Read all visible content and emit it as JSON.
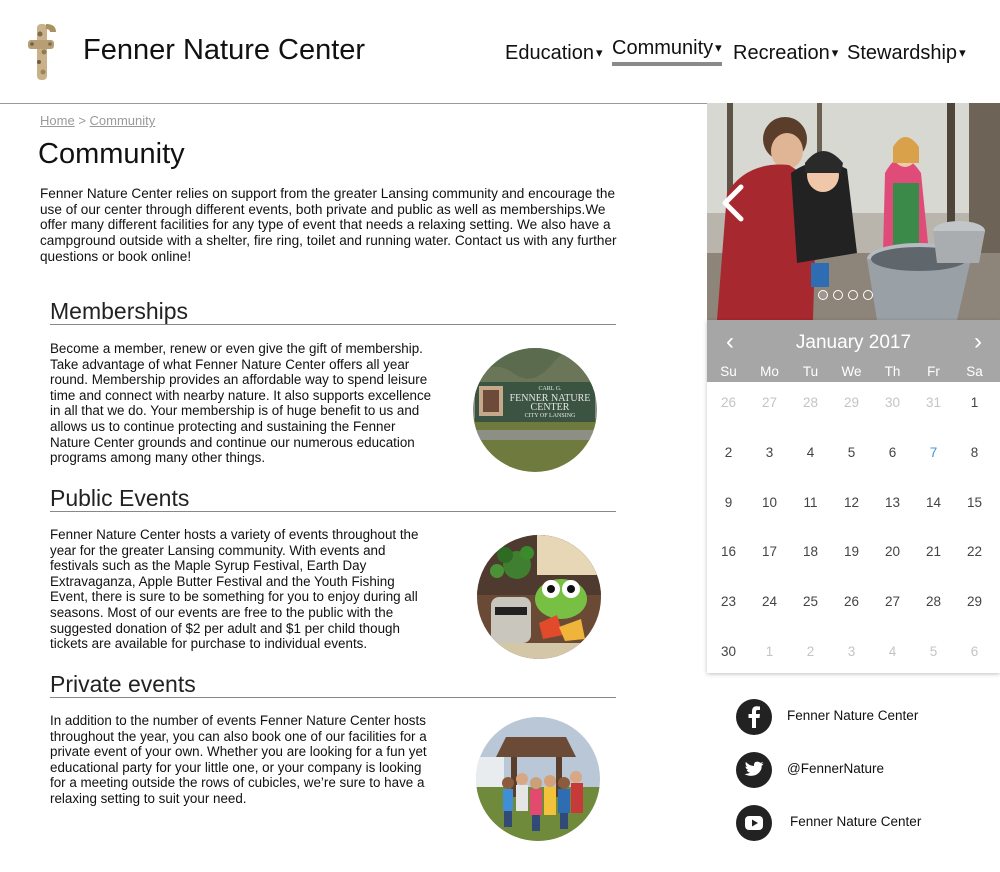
{
  "header": {
    "title": "Fenner Nature Center",
    "nav": [
      {
        "label": "Education",
        "caret": "▾"
      },
      {
        "label": "Community",
        "caret": "▾"
      },
      {
        "label": "Recreation",
        "caret": "▾"
      },
      {
        "label": "Stewardship",
        "caret": "▾"
      }
    ]
  },
  "breadcrumb": {
    "home": "Home",
    "separator": ">",
    "current": "Community"
  },
  "page": {
    "title": "Community",
    "intro": "Fenner Nature Center relies on support from the greater Lansing community and encourage the use of our center through different events, both private and public as well as memberships.We offer many different facilities for any type of event that needs a relaxing setting. We also have a campground outside with a shelter, fire ring, toilet and running water. Contact us with any further questions or book online!"
  },
  "sections": [
    {
      "heading": "Memberships",
      "body": "Become a member, renew or even give the gift of membership. Take advantage of what Fenner Nature Center offers all year round. Membership provides an affordable way to spend leisure time and connect with nearby nature. It also supports excellence in all that we do. Your membership is of huge benefit to us and allows us to continue protecting and sustaining the Fenner Nature Center grounds and continue our numerous education programs among many other things."
    },
    {
      "heading": "Public Events",
      "body": "Fenner Nature Center hosts a variety of events throughout the year for the greater Lansing community. With events and festivals such as the Maple Syrup Festival, Earth Day Extravaganza, Apple Butter Festival and the Youth Fishing Event, there is sure to be something for you to enjoy during all seasons. Most of our events are free to the public with the suggested donation of $2 per adult and $1 per child though tickets are available for purchase to individual events."
    },
    {
      "heading": "Private events",
      "body": "In addition to the number of events Fenner Nature Center hosts throughout the year, you can also book one of our facilities for a private event of your own. Whether you are looking for a fun yet educational party for your little one, or your company is looking for a meeting outside the rows of cubicles, we’re sure to have a relaxing setting to suit your need."
    }
  ],
  "sign": {
    "line1": "CARL G.",
    "line2": "FENNER NATURE",
    "line3": "CENTER",
    "line4": "CITY OF LANSING"
  },
  "slideshow": {
    "slide_count": 4,
    "active_slide": 1
  },
  "calendar": {
    "month": "January 2017",
    "prev": "‹",
    "next": "›",
    "weekdays": [
      "Su",
      "Mo",
      "Tu",
      "We",
      "Th",
      "Fr",
      "Sa"
    ],
    "weeks": [
      [
        "26",
        "27",
        "28",
        "29",
        "30",
        "31",
        "1"
      ],
      [
        "2",
        "3",
        "4",
        "5",
        "6",
        "7",
        "8"
      ],
      [
        "9",
        "10",
        "11",
        "12",
        "13",
        "14",
        "15"
      ],
      [
        "16",
        "17",
        "18",
        "19",
        "20",
        "21",
        "22"
      ],
      [
        "23",
        "24",
        "25",
        "26",
        "27",
        "28",
        "29"
      ],
      [
        "30",
        "1",
        "2",
        "3",
        "4",
        "5",
        "6"
      ]
    ],
    "highlight_day": "7",
    "highlight_color": "#4a90d9"
  },
  "social": [
    {
      "icon": "facebook-icon",
      "label": "Fenner Nature Center"
    },
    {
      "icon": "twitter-icon",
      "label": "@FennerNature"
    },
    {
      "icon": "youtube-icon",
      "label": "Fenner Nature Center"
    }
  ]
}
